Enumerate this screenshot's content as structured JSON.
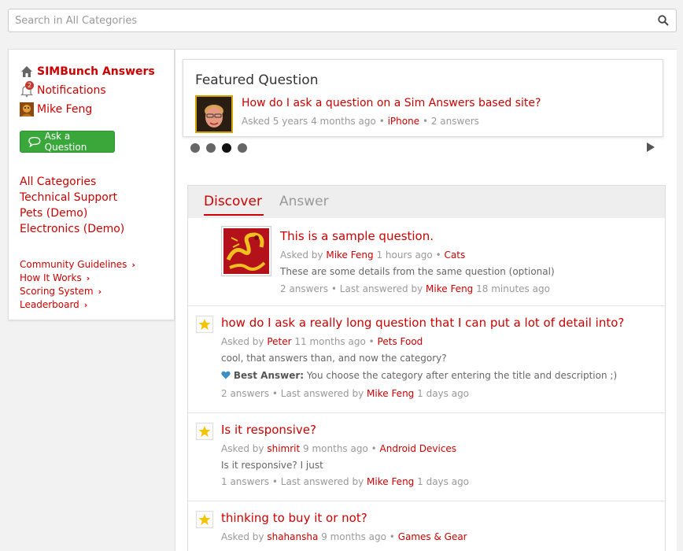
{
  "search": {
    "placeholder": "Search in All Categories",
    "icon": "search-icon"
  },
  "sidebar": {
    "site_title": "SIMBunch Answers",
    "notifications_label": "Notifications",
    "notifications_badge": "2",
    "user_name": "Mike Feng",
    "ask_button": "Ask a Question",
    "categories": [
      "All Categories",
      "Technical Support",
      "Pets (Demo)",
      "Electronics (Demo)"
    ],
    "links": [
      "Community Guidelines",
      "How It Works",
      "Scoring System",
      "Leaderboard"
    ]
  },
  "featured": {
    "heading": "Featured Question",
    "title": "How do I ask a question on a Sim Answers based site?",
    "asked": "Asked 5 years 4 months ago",
    "sep": "•",
    "category": "iPhone",
    "answers": "2 answers",
    "active_dot": 3,
    "dot_count": 4
  },
  "tabs": {
    "discover": "Discover",
    "answer": "Answer"
  },
  "questions": [
    {
      "title": "This is a sample question.",
      "asked_by": "Asked by",
      "author": "Mike Feng",
      "time": "1 hours ago",
      "category": "Cats",
      "detail": "These are some details from the same question (optional)",
      "answers": "2 answers",
      "last_by": "Last answered by",
      "last_user": "Mike Feng",
      "last_time": "18 minutes ago"
    },
    {
      "title": "how do I ask a really long question that I can put a lot of detail into?",
      "asked_by": "Asked by",
      "author": "Peter",
      "time": "11 months ago",
      "category": "Pets Food",
      "detail": "cool, that answers than, and now the category?",
      "best_label": "Best Answer:",
      "best_text": "You choose the category after entering the title and description ;)",
      "answers": "2 answers",
      "last_by": "Last answered by",
      "last_user": "Mike Feng",
      "last_time": "1 days ago"
    },
    {
      "title": "Is it responsive?",
      "asked_by": "Asked by",
      "author": "shimrit",
      "time": "9 months ago",
      "category": "Android Devices",
      "detail": "Is it responsive? I just",
      "answers": "1 answers",
      "last_by": "Last answered by",
      "last_user": "Mike Feng",
      "last_time": "1 days ago"
    },
    {
      "title": "thinking to buy it or not?",
      "asked_by": "Asked by",
      "author": "shahansha",
      "time": "9 months ago",
      "category": "Games & Gear"
    }
  ],
  "colors": {
    "accent": "#cc0000",
    "button": "#3aa73a",
    "star": "#f5c400",
    "heart": "#3b8fc4"
  }
}
